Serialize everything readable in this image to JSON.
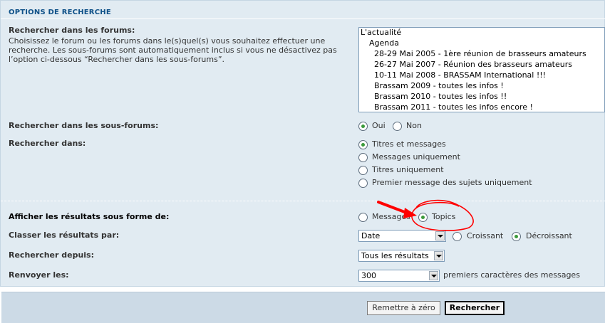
{
  "section": {
    "title": "OPTIONS DE RECHERCHE"
  },
  "forums": {
    "label": "Rechercher dans les forums:",
    "explain": "Choisissez le forum ou les forums dans le(s)quel(s) vous souhaitez effectuer une recherche. Les sous-forums sont automatiquement inclus si vous ne désactivez pas l’option ci-dessous “Rechercher dans les sous-forums”.",
    "list": [
      "L'actualité",
      "Agenda",
      "28-29 Mai 2005 - 1ère réunion de brasseurs amateurs",
      "26-27 Mai 2007 - Réunion des brasseurs amateurs",
      "10-11 Mai 2008 - BRASSAM International !!!",
      "Brassam 2009 - toutes les infos !",
      "Brassam 2010 - toutes les infos !!",
      "Brassam 2011 - toutes les infos encore !"
    ]
  },
  "subforums": {
    "label": "Rechercher dans les sous-forums:",
    "options": [
      "Oui",
      "Non"
    ],
    "selected": "Oui"
  },
  "search_in": {
    "label": "Rechercher dans:",
    "options": [
      "Titres et messages",
      "Messages uniquement",
      "Titres uniquement",
      "Premier message des sujets uniquement"
    ],
    "selected": "Titres et messages"
  },
  "display": {
    "label": "Afficher les résultats sous forme de:",
    "options": [
      "Messages",
      "Topics"
    ],
    "selected": "Topics"
  },
  "sort": {
    "label": "Classer les résultats par:",
    "field": "Date",
    "directions": [
      "Croissant",
      "Décroissant"
    ],
    "selected_direction": "Décroissant"
  },
  "since": {
    "label": "Rechercher depuis:",
    "value": "Tous les résultats"
  },
  "return": {
    "label": "Renvoyer les:",
    "value": "300",
    "suffix": "premiers caractères des messages"
  },
  "buttons": {
    "reset": "Remettre à zéro",
    "search": "Rechercher"
  },
  "colors": {
    "panel_bg": "#e1ebf2",
    "title": "#105289",
    "annotation": "#ff0000"
  }
}
